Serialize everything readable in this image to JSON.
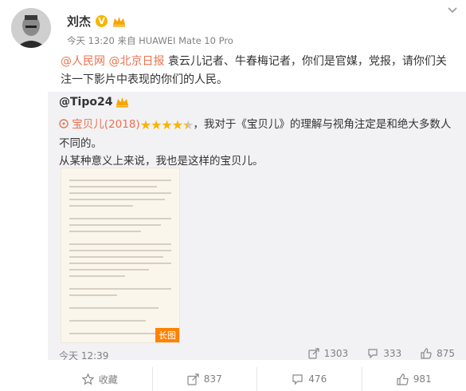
{
  "post": {
    "author": "刘杰",
    "verified_badge": "V",
    "meta_time": "今天 13:20",
    "meta_source_prefix": "来自",
    "meta_source": "HUAWEI Mate 10 Pro",
    "mention_1": "@人民网",
    "mention_2": "@北京日报",
    "text": "袁云儿记者、牛春梅记者，你们是官媒，党报，请你们关注一下影片中表现的你们的人民。"
  },
  "repost": {
    "user": "@Tipo24",
    "movie_tag": "宝贝儿(2018)",
    "rating": 4.5,
    "text_line1": "，我对于《宝贝儿》的理解与视角注定是和绝大多数人不同的。",
    "text_line2": "从某种意义上来说，我也是这样的宝贝儿。",
    "long_image_badge": "长图",
    "time": "今天 12:39",
    "reposts": "1303",
    "comments": "333",
    "likes": "875"
  },
  "actions": {
    "favorite": "收藏",
    "repost": "837",
    "comment": "476",
    "like": "981"
  },
  "colors": {
    "accent": "#eb7350",
    "star": "#f7b500",
    "badge_orange": "#ff8200"
  }
}
